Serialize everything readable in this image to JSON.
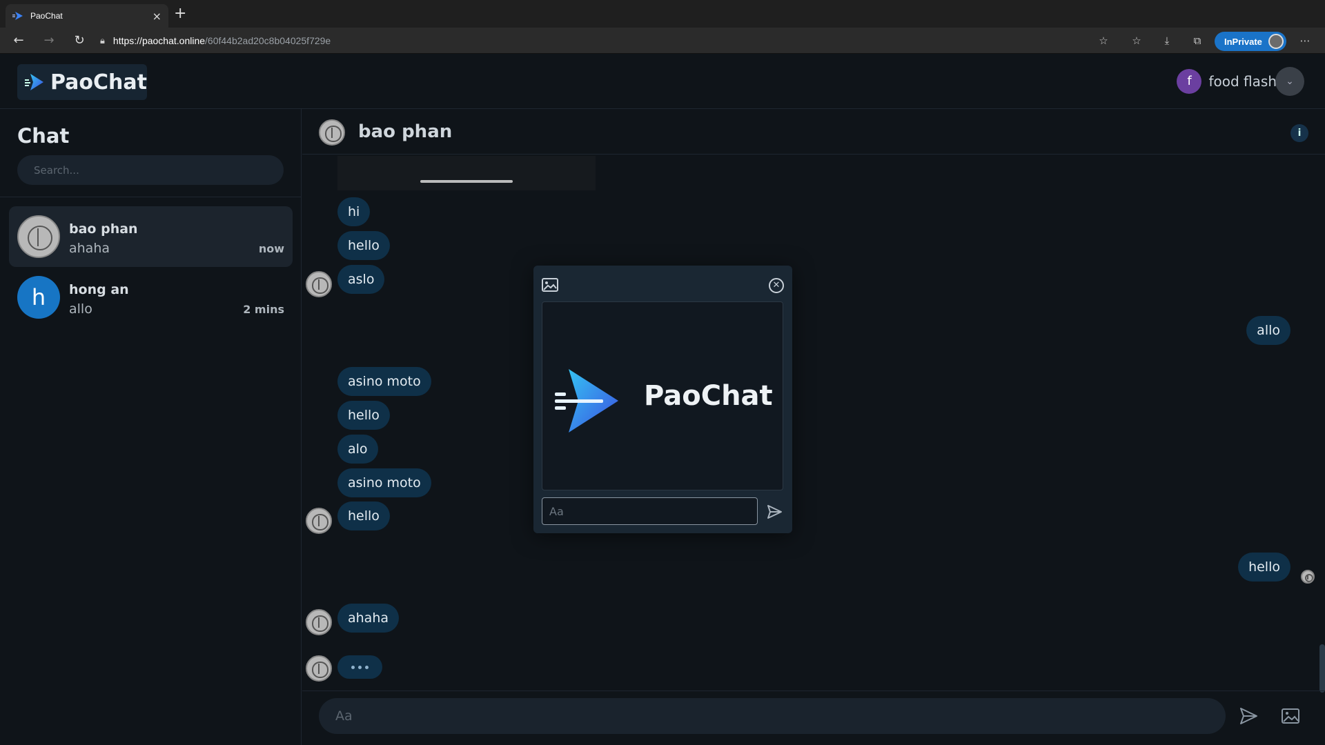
{
  "browser": {
    "tab_title": "PaoChat",
    "url_host": "https://paochat.online",
    "url_path": "/60f44b2ad20c8b04025f729e",
    "inprivate_label": "InPrivate"
  },
  "app": {
    "logo_text": "PaoChat",
    "user_initial": "f",
    "user_name": "food flash",
    "accent_color": "#0f3048"
  },
  "sidebar": {
    "title": "Chat",
    "search_placeholder": "Search...",
    "conversations": [
      {
        "name": "bao phan",
        "last_message": "ahaha",
        "time": "now",
        "active": true
      },
      {
        "name": "hong an",
        "initial": "h",
        "last_message": "allo",
        "time": "2 mins",
        "active": false
      }
    ]
  },
  "chat": {
    "contact_name": "bao phan",
    "info_label": "i",
    "messages": [
      {
        "text": "hi",
        "side": "left"
      },
      {
        "text": "hello",
        "side": "left"
      },
      {
        "text": "aslo",
        "side": "left"
      },
      {
        "text": "allo",
        "side": "right"
      },
      {
        "text": "asino moto",
        "side": "left"
      },
      {
        "text": "hello",
        "side": "left"
      },
      {
        "text": "alo",
        "side": "left"
      },
      {
        "text": "asino moto",
        "side": "left"
      },
      {
        "text": "hello",
        "side": "left"
      },
      {
        "text": "hello",
        "side": "right"
      },
      {
        "text": "ahaha",
        "side": "left"
      }
    ],
    "composer_placeholder": "Aa"
  },
  "modal": {
    "preview_logo_text": "PaoChat",
    "caption_placeholder": "Aa"
  }
}
